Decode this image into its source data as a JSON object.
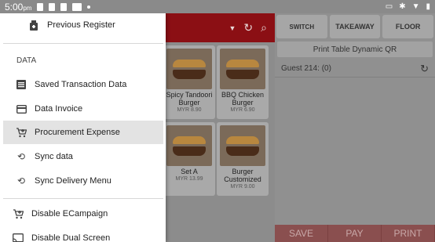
{
  "status_bar": {
    "time": "5:00",
    "ampm": "pm"
  },
  "drawer": {
    "previous_register": "Previous Register",
    "section_data": "DATA",
    "items": [
      {
        "label": "Saved Transaction Data",
        "icon": "list-icon"
      },
      {
        "label": "Data Invoice",
        "icon": "card-icon"
      },
      {
        "label": "Procurement Expense",
        "icon": "cart-icon",
        "active": true
      },
      {
        "label": "Sync data",
        "icon": "sync-icon"
      },
      {
        "label": "Sync Delivery Menu",
        "icon": "sync-icon"
      }
    ],
    "extra": [
      {
        "label": "Disable ECampaign",
        "icon": "cart-icon"
      },
      {
        "label": "Disable Dual Screen",
        "icon": "cast-icon"
      }
    ]
  },
  "menu_items": [
    {
      "name_line1": "Spicy Tandoori",
      "name_line2": "Burger",
      "price": "MYR 8.90"
    },
    {
      "name_line1": "BBQ Chicken",
      "name_line2": "Burger",
      "price": "MYR 6.90"
    },
    {
      "name_line1": "Set A",
      "name_line2": "",
      "price": "MYR 13.99"
    },
    {
      "name_line1": "Burger",
      "name_line2": "Customized",
      "price": "MYR 9.00"
    }
  ],
  "right_panel": {
    "tabs": [
      "SWITCH",
      "TAKEAWAY",
      "FLOOR"
    ],
    "qr_button": "Print Table Dynamic QR",
    "guest": "Guest 214: (0)",
    "actions": [
      "SAVE",
      "PAY",
      "PRINT"
    ]
  }
}
